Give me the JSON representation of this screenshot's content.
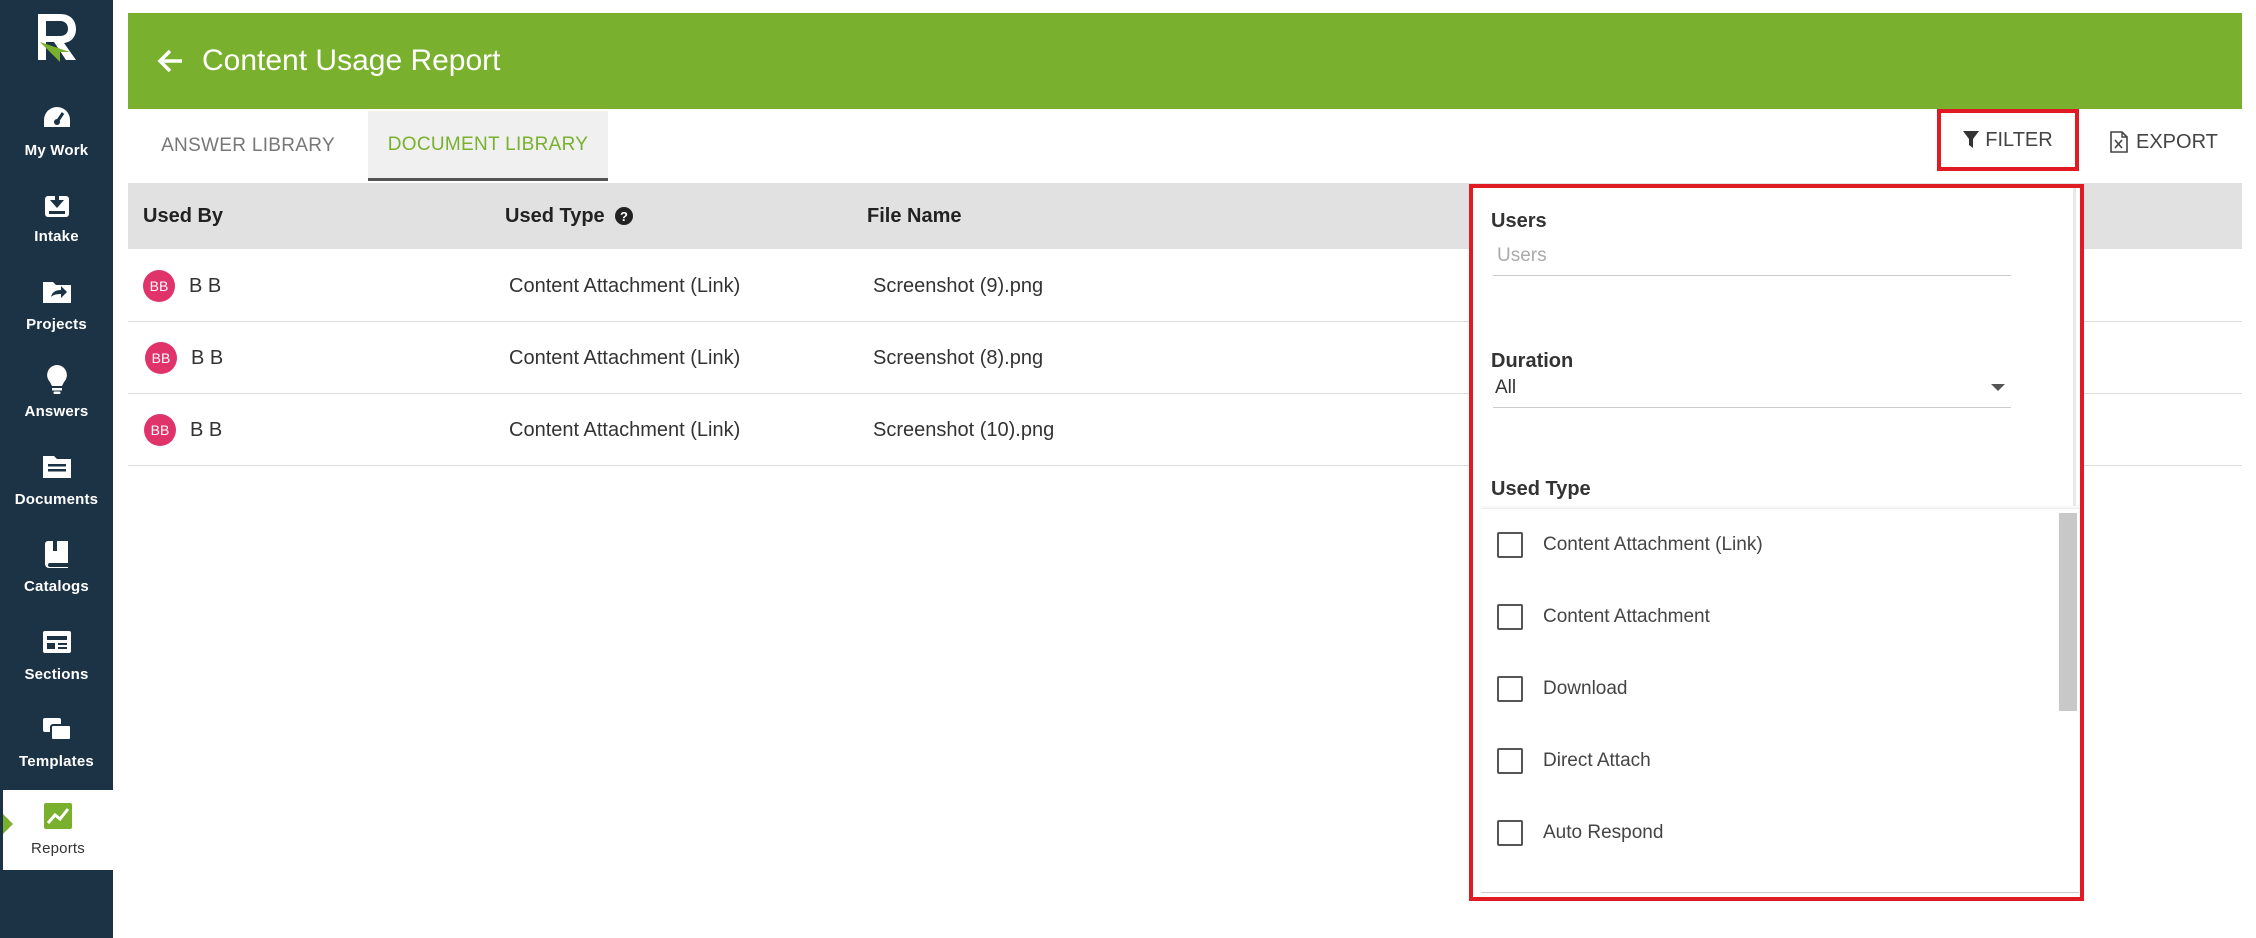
{
  "sidebar": {
    "items": [
      {
        "label": "My Work",
        "icon": "gauge-icon"
      },
      {
        "label": "Intake",
        "icon": "inbox-download-icon"
      },
      {
        "label": "Projects",
        "icon": "folder-share-icon"
      },
      {
        "label": "Answers",
        "icon": "lightbulb-icon"
      },
      {
        "label": "Documents",
        "icon": "documents-icon"
      },
      {
        "label": "Catalogs",
        "icon": "book-icon"
      },
      {
        "label": "Sections",
        "icon": "sections-icon"
      },
      {
        "label": "Templates",
        "icon": "templates-icon"
      },
      {
        "label": "Reports",
        "icon": "chart-icon"
      }
    ],
    "active": "Reports"
  },
  "header": {
    "title": "Content Usage Report",
    "color": "#79b02d"
  },
  "tabs": [
    {
      "label": "ANSWER LIBRARY"
    },
    {
      "label": "DOCUMENT LIBRARY"
    }
  ],
  "toolbar": {
    "filter_label": "FILTER",
    "export_label": "EXPORT"
  },
  "table": {
    "headers": {
      "used_by": "Used By",
      "used_type": "Used Type",
      "file_name": "File Name"
    },
    "rows": [
      {
        "initials": "BB",
        "user": "B B",
        "used_type": "Content Attachment (Link)",
        "file_name": "Screenshot (9).png"
      },
      {
        "initials": "BB",
        "user": "B B",
        "used_type": "Content Attachment (Link)",
        "file_name": "Screenshot (8).png"
      },
      {
        "initials": "BB",
        "user": "B B",
        "used_type": "Content Attachment (Link)",
        "file_name": "Screenshot (10).png"
      }
    ]
  },
  "filter_panel": {
    "users_label": "Users",
    "users_placeholder": "Users",
    "duration_label": "Duration",
    "duration_value": "All",
    "used_type_label": "Used Type",
    "options": [
      {
        "label": "Content Attachment (Link)",
        "checked": false
      },
      {
        "label": "Content Attachment",
        "checked": false
      },
      {
        "label": "Download",
        "checked": false
      },
      {
        "label": "Direct Attach",
        "checked": false
      },
      {
        "label": "Auto Respond",
        "checked": false
      }
    ]
  }
}
